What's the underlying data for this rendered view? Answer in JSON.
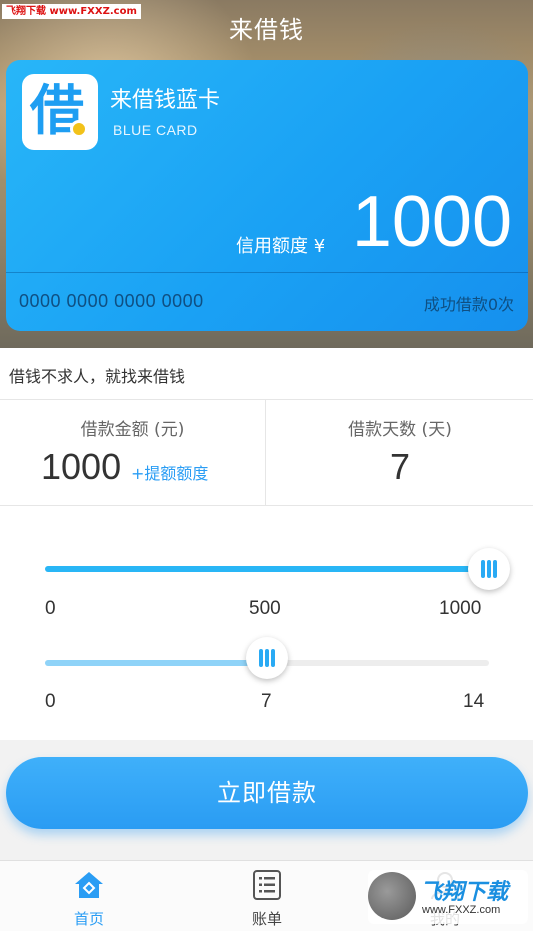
{
  "watermark_top": "飞翔下载 www.FXXZ.com",
  "app_title": "来借钱",
  "card": {
    "logo_glyph": "借",
    "name": "来借钱蓝卡",
    "subtitle": "BLUE CARD",
    "credit_label": "信用额度 ¥",
    "credit_amount": "1000",
    "card_number": "0000 0000 0000 0000",
    "loan_status": "成功借款0次"
  },
  "slogan": "借钱不求人，就找来借钱",
  "loan_amount": {
    "label": "借款金额 (元)",
    "value": "1000",
    "raise_link": "+提额额度"
  },
  "loan_days": {
    "label": "借款天数 (天)",
    "value": "7"
  },
  "amount_slider": {
    "min": 0,
    "max": 1000,
    "value": 1000,
    "ticks": [
      "0",
      "500",
      "1000"
    ],
    "color": "#29b6f6"
  },
  "days_slider": {
    "min": 0,
    "max": 14,
    "value": 7,
    "ticks": [
      "0",
      "7",
      "14"
    ],
    "color": "#8fd3f8"
  },
  "cta_label": "立即借款",
  "tabs": [
    {
      "label": "首页",
      "icon": "home-icon",
      "active": true
    },
    {
      "label": "账单",
      "icon": "bill-list-icon",
      "active": false
    },
    {
      "label": "我的",
      "icon": "user-icon",
      "active": false
    }
  ],
  "watermark_bottom": {
    "text": "飞翔下载",
    "url": "www.FXXZ.com"
  },
  "colors": {
    "accent": "#2a9df4",
    "card_start": "#28b6f8",
    "card_end": "#1690ee"
  }
}
